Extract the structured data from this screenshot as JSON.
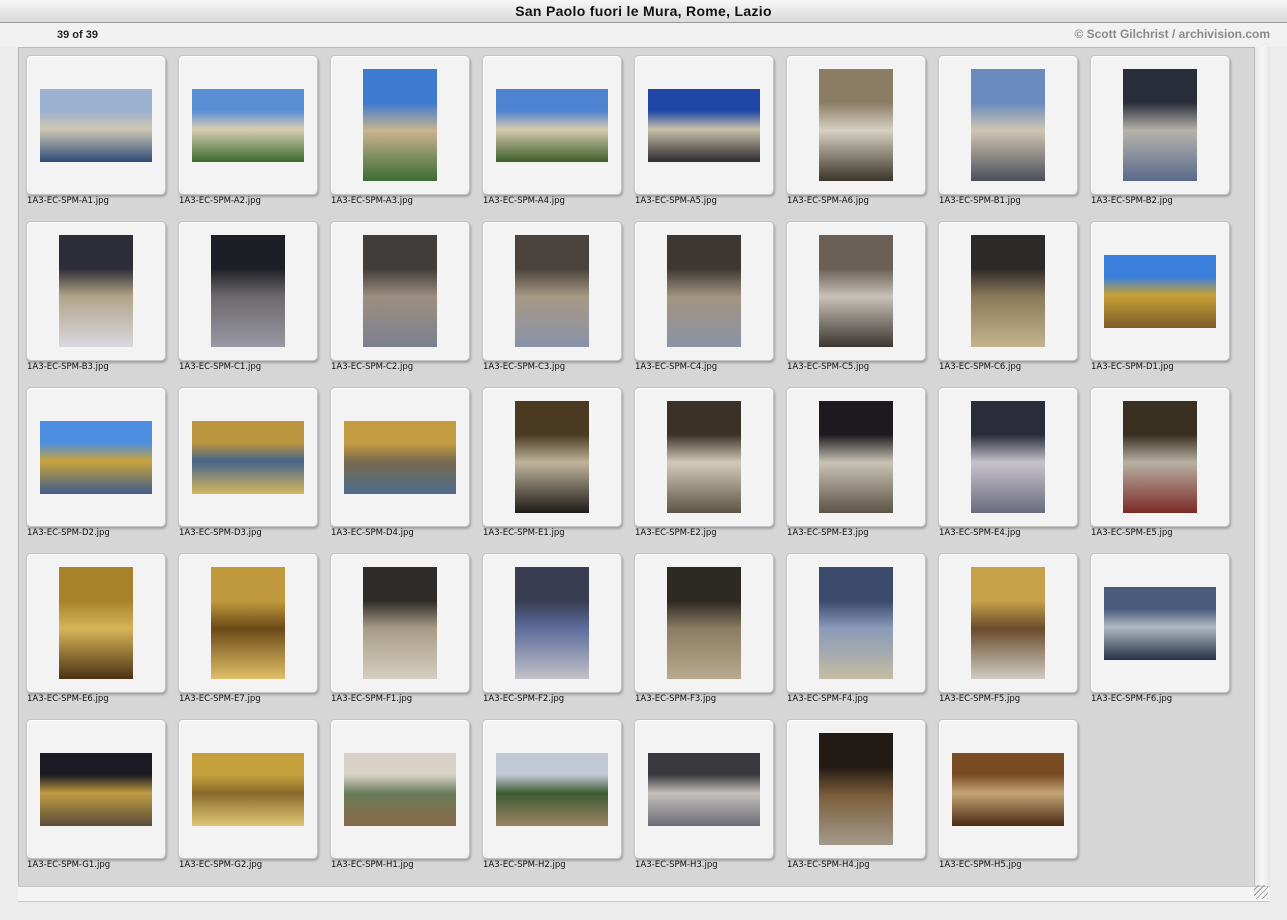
{
  "window": {
    "title": "San Paolo fuori le Mura, Rome, Lazio"
  },
  "header": {
    "count": "39 of 39",
    "credit": "© Scott Gilchrist / archivision.com"
  },
  "colors": {
    "pane_bg": "#d6d6d6",
    "slide_bg": "#f3f3f3"
  },
  "thumbnails": [
    {
      "filename": "1A3-EC-SPM-A1.jpg",
      "orientation": "h",
      "colors": [
        "#9cb1cf",
        "#cfc7b4",
        "#2e4a78"
      ]
    },
    {
      "filename": "1A3-EC-SPM-A2.jpg",
      "orientation": "h",
      "colors": [
        "#5a8fd6",
        "#d8cdb3",
        "#3a6a2c"
      ]
    },
    {
      "filename": "1A3-EC-SPM-A3.jpg",
      "orientation": "v",
      "colors": [
        "#3d7ad0",
        "#c9b58e",
        "#3c6b34"
      ]
    },
    {
      "filename": "1A3-EC-SPM-A4.jpg",
      "orientation": "h",
      "colors": [
        "#4e83d1",
        "#d6cbb0",
        "#3e5e2a"
      ]
    },
    {
      "filename": "1A3-EC-SPM-A5.jpg",
      "orientation": "h",
      "colors": [
        "#1f48a8",
        "#c9c0a8",
        "#2b2b30"
      ]
    },
    {
      "filename": "1A3-EC-SPM-A6.jpg",
      "orientation": "v",
      "colors": [
        "#8b7d64",
        "#d7d1c4",
        "#3b3428"
      ]
    },
    {
      "filename": "1A3-EC-SPM-B1.jpg",
      "orientation": "v",
      "colors": [
        "#6a8bbf",
        "#cfc6b2",
        "#4a4f5c"
      ]
    },
    {
      "filename": "1A3-EC-SPM-B2.jpg",
      "orientation": "v",
      "colors": [
        "#2a2e3a",
        "#b7b3aa",
        "#5a6a8c"
      ]
    },
    {
      "filename": "1A3-EC-SPM-B3.jpg",
      "orientation": "v",
      "colors": [
        "#2c2d36",
        "#b2a58a",
        "#d8d8de"
      ]
    },
    {
      "filename": "1A3-EC-SPM-C1.jpg",
      "orientation": "v",
      "colors": [
        "#1e1f26",
        "#6c6a6c",
        "#9a98a4"
      ]
    },
    {
      "filename": "1A3-EC-SPM-C2.jpg",
      "orientation": "v",
      "colors": [
        "#413d3a",
        "#9d8f80",
        "#7c8090"
      ]
    },
    {
      "filename": "1A3-EC-SPM-C3.jpg",
      "orientation": "v",
      "colors": [
        "#4a423c",
        "#a69985",
        "#8a92a8"
      ]
    },
    {
      "filename": "1A3-EC-SPM-C4.jpg",
      "orientation": "v",
      "colors": [
        "#3d3834",
        "#a29480",
        "#8c93a6"
      ]
    },
    {
      "filename": "1A3-EC-SPM-C5.jpg",
      "orientation": "v",
      "colors": [
        "#6a6058",
        "#c8c2ba",
        "#3c3632"
      ]
    },
    {
      "filename": "1A3-EC-SPM-C6.jpg",
      "orientation": "v",
      "colors": [
        "#2c2a28",
        "#8a7a5a",
        "#c4b48c"
      ]
    },
    {
      "filename": "1A3-EC-SPM-D1.jpg",
      "orientation": "h",
      "colors": [
        "#3b7fdc",
        "#c9a236",
        "#7b5a2a"
      ]
    },
    {
      "filename": "1A3-EC-SPM-D2.jpg",
      "orientation": "h",
      "colors": [
        "#4d8ee0",
        "#c8a43a",
        "#3f5c8c"
      ]
    },
    {
      "filename": "1A3-EC-SPM-D3.jpg",
      "orientation": "h",
      "colors": [
        "#b9953e",
        "#45638a",
        "#d4b85c"
      ]
    },
    {
      "filename": "1A3-EC-SPM-D4.jpg",
      "orientation": "h",
      "colors": [
        "#c49c42",
        "#7a6a4c",
        "#4c6c8c"
      ]
    },
    {
      "filename": "1A3-EC-SPM-E1.jpg",
      "orientation": "v",
      "colors": [
        "#4a3a22",
        "#bfb49a",
        "#1e1c1a"
      ]
    },
    {
      "filename": "1A3-EC-SPM-E2.jpg",
      "orientation": "v",
      "colors": [
        "#3a3226",
        "#d2cbbb",
        "#5d5446"
      ]
    },
    {
      "filename": "1A3-EC-SPM-E3.jpg",
      "orientation": "v",
      "colors": [
        "#1c1a1e",
        "#c9c3b6",
        "#5c5446"
      ]
    },
    {
      "filename": "1A3-EC-SPM-E4.jpg",
      "orientation": "v",
      "colors": [
        "#2a2c3c",
        "#c6c3c8",
        "#6a6a80"
      ]
    },
    {
      "filename": "1A3-EC-SPM-E5.jpg",
      "orientation": "v",
      "colors": [
        "#3a3022",
        "#b7b0a4",
        "#7c2a24"
      ]
    },
    {
      "filename": "1A3-EC-SPM-E6.jpg",
      "orientation": "v",
      "colors": [
        "#a8822a",
        "#d6b558",
        "#4a3214"
      ]
    },
    {
      "filename": "1A3-EC-SPM-E7.jpg",
      "orientation": "v",
      "colors": [
        "#c09a3c",
        "#6c4a18",
        "#e0c068"
      ]
    },
    {
      "filename": "1A3-EC-SPM-F1.jpg",
      "orientation": "v",
      "colors": [
        "#2e2c2a",
        "#a89c86",
        "#d4cec2"
      ]
    },
    {
      "filename": "1A3-EC-SPM-F2.jpg",
      "orientation": "v",
      "colors": [
        "#3a3c52",
        "#5d6c9c",
        "#c4c2c8"
      ]
    },
    {
      "filename": "1A3-EC-SPM-F3.jpg",
      "orientation": "v",
      "colors": [
        "#2c2822",
        "#8c7c64",
        "#b8aa8e"
      ]
    },
    {
      "filename": "1A3-EC-SPM-F4.jpg",
      "orientation": "v",
      "colors": [
        "#3c4a6c",
        "#8a9ab8",
        "#c4bca4"
      ]
    },
    {
      "filename": "1A3-EC-SPM-F5.jpg",
      "orientation": "v",
      "colors": [
        "#c8a24a",
        "#6a4c2c",
        "#d0ccc4"
      ]
    },
    {
      "filename": "1A3-EC-SPM-F6.jpg",
      "orientation": "h",
      "colors": [
        "#4a5c7c",
        "#b2b8c4",
        "#263248"
      ]
    },
    {
      "filename": "1A3-EC-SPM-G1.jpg",
      "orientation": "h",
      "colors": [
        "#1c1a22",
        "#c09c42",
        "#5a4c3a"
      ]
    },
    {
      "filename": "1A3-EC-SPM-G2.jpg",
      "orientation": "h",
      "colors": [
        "#c4a03c",
        "#8a6a2c",
        "#e0c874"
      ]
    },
    {
      "filename": "1A3-EC-SPM-H1.jpg",
      "orientation": "h",
      "colors": [
        "#d8d2c6",
        "#6a7c5a",
        "#8a6a4a"
      ]
    },
    {
      "filename": "1A3-EC-SPM-H2.jpg",
      "orientation": "h",
      "colors": [
        "#c2c8d4",
        "#3e5a32",
        "#9c8464"
      ]
    },
    {
      "filename": "1A3-EC-SPM-H3.jpg",
      "orientation": "h",
      "colors": [
        "#3a3a3e",
        "#c4c0bc",
        "#6c6c76"
      ]
    },
    {
      "filename": "1A3-EC-SPM-H4.jpg",
      "orientation": "v",
      "colors": [
        "#221a14",
        "#7a5c3a",
        "#a49a8a"
      ]
    },
    {
      "filename": "1A3-EC-SPM-H5.jpg",
      "orientation": "h",
      "colors": [
        "#7a4c24",
        "#c4a474",
        "#4a2a14"
      ]
    }
  ]
}
